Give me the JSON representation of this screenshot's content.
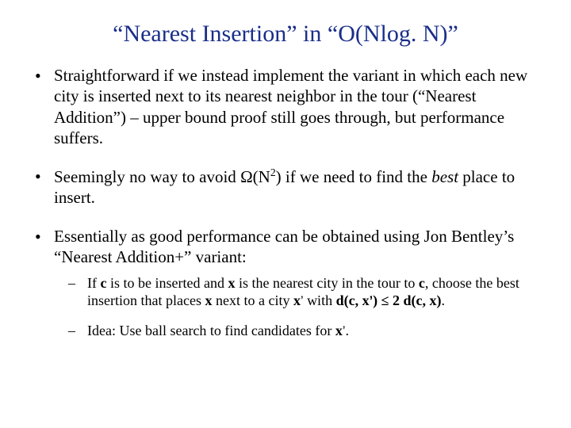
{
  "title": {
    "q1": "“",
    "t1": "Nearest Insertion",
    "q2": "”",
    "t2": " in ",
    "q3": "“",
    "t3": "O(Nlog. N)",
    "q4": "”"
  },
  "bullets": {
    "b1": "Straightforward if we instead implement the variant in which each new city is inserted next to its nearest neighbor in the tour (“Nearest Addition”) – upper bound proof still goes through, but performance suffers.",
    "b2": {
      "a": "Seemingly no way to avoid ",
      "omega": "Ω",
      "b": "(N",
      "exp": "2",
      "c": ") if we need to find the ",
      "best": "best",
      "d": " place to insert."
    },
    "b3": "Essentially as good performance can be obtained using Jon Bentley’s “Nearest Addition+” variant:",
    "sub1": {
      "a": "If ",
      "c1": "c",
      "b": " is to be inserted and ",
      "x1": "x",
      "c": " is the nearest city in the tour to ",
      "c2": "c",
      "d": ", choose the best insertion that places ",
      "x2": "x",
      "e": " next to a city ",
      "x3": "x",
      "pr1": "’",
      "f": " with ",
      "g": "d(c, x",
      "pr2": "’",
      "h": ") ≤ 2 d(c, x)",
      "i": "."
    },
    "sub2": {
      "a": "Idea: Use ball search to find candidates for ",
      "x": "x",
      "pr": "’",
      "b": "."
    }
  }
}
